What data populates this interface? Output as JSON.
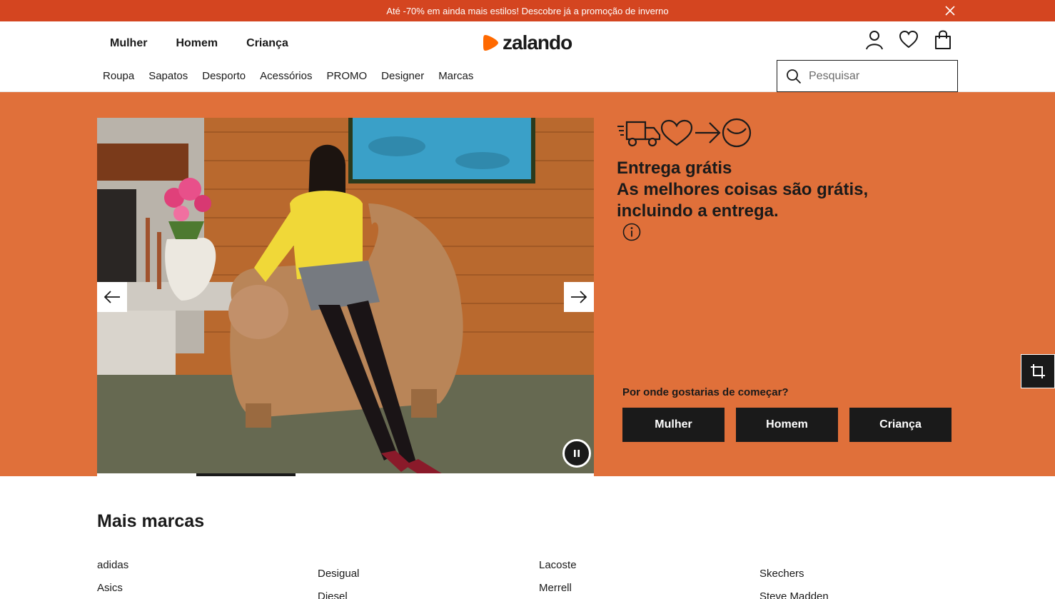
{
  "promo": {
    "text": "Até -70% em ainda mais estilos! Descobre já a promoção de inverno",
    "close_icon": "close-icon"
  },
  "header": {
    "gender_nav": [
      "Mulher",
      "Homem",
      "Criança"
    ],
    "logo_text": "zalando",
    "brand_color": "#ff6900",
    "icons": [
      "user-icon",
      "heart-icon",
      "bag-icon"
    ],
    "category_nav": [
      "Roupa",
      "Sapatos",
      "Desporto",
      "Acessórios",
      "PROMO",
      "Designer",
      "Marcas"
    ],
    "search": {
      "placeholder": "Pesquisar",
      "value": ""
    }
  },
  "hero": {
    "background_color": "#e0703a",
    "benefit_line1": "Entrega grátis",
    "benefit_line2": "As melhores coisas são grátis,",
    "benefit_line3": "incluindo a entrega.",
    "start_label": "Por onde gostarias de começar?",
    "start_buttons": [
      "Mulher",
      "Homem",
      "Criança"
    ],
    "carousel": {
      "prev_icon": "arrow-left-icon",
      "next_icon": "arrow-right-icon",
      "pause_icon": "pause-icon",
      "active_slide_fraction": 0.2
    }
  },
  "brands": {
    "title": "Mais marcas",
    "columns": [
      [
        "adidas",
        "Asics"
      ],
      [
        "Desigual",
        "Diesel"
      ],
      [
        "Lacoste",
        "Merrell"
      ],
      [
        "Skechers",
        "Steve Madden"
      ]
    ]
  }
}
